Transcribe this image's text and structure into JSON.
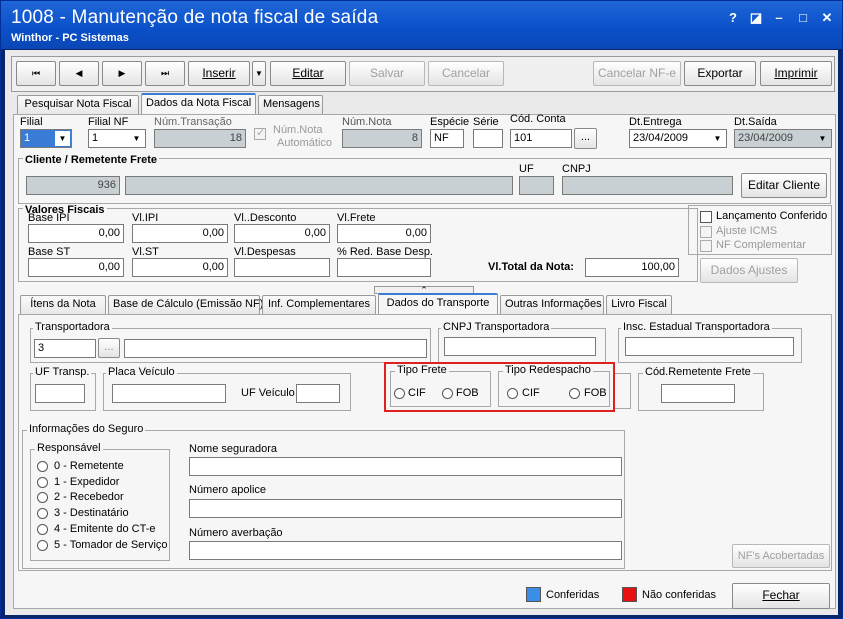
{
  "window": {
    "title": "1008 - Manutenção de nota fiscal de saída",
    "subtitle": "Winthor - PC Sistemas",
    "help": "?",
    "restore": "◪",
    "minimize": "–",
    "maximize": "□",
    "close": "✕"
  },
  "toolbar": {
    "first": "⏮",
    "prev": "◀",
    "next": "▶",
    "last": "⏭",
    "inserir": "Inserir",
    "inserir_drop": "▼",
    "editar": "Editar",
    "salvar": "Salvar",
    "cancelar": "Cancelar",
    "cancelar_nfe": "Cancelar NF-e",
    "exportar": "Exportar",
    "imprimir": "Imprimir"
  },
  "top_tabs": [
    "Pesquisar Nota Fiscal",
    "Dados da Nota Fiscal",
    "Mensagens"
  ],
  "header": {
    "filial_label": "Filial",
    "filial_value": "1",
    "filial_nf_label": "Filial NF",
    "filial_nf_value": "1",
    "num_transacao_label": "Núm.Transação",
    "num_transacao_value": "18",
    "num_nota_auto_label_1": "Núm.Nota",
    "num_nota_auto_label_2": "Automático",
    "num_nota_label": "Núm.Nota",
    "num_nota_value": "8",
    "especie_label": "Espécie",
    "especie_value": "NF",
    "serie_label": "Série",
    "serie_value": "",
    "cod_conta_label": "Cód. Conta",
    "cod_conta_value": "101",
    "cod_conta_btn": "...",
    "dt_entrega_label": "Dt.Entrega",
    "dt_entrega_value": "23/04/2009",
    "dt_saida_label": "Dt.Saída",
    "dt_saida_value": "23/04/2009"
  },
  "cliente": {
    "title": "Cliente / Remetente Frete",
    "code": "936",
    "name": "",
    "uf_label": "UF",
    "uf_value": "",
    "cnpj_label": "CNPJ",
    "cnpj_value": "",
    "editar_btn": "Editar Cliente"
  },
  "valores": {
    "title": "Valores Fiscais",
    "base_ipi_label": "Base IPI",
    "base_ipi": "0,00",
    "vl_ipi_label": "Vl.IPI",
    "vl_ipi": "0,00",
    "vl_desconto_label": "Vl..Desconto",
    "vl_desconto": "0,00",
    "vl_frete_label": "Vl.Frete",
    "vl_frete": "0,00",
    "base_st_label": "Base ST",
    "base_st": "0,00",
    "vl_st_label": "Vl.ST",
    "vl_st": "0,00",
    "vl_despesas_label": "Vl.Despesas",
    "vl_despesas": "",
    "red_base_label": "% Red. Base Desp.",
    "red_base": "",
    "vl_total_label": "Vl.Total da Nota:",
    "vl_total": "100,00"
  },
  "flags": {
    "lancamento": "Lançamento Conferido",
    "ajuste_icms": "Ajuste ICMS",
    "nf_complementar": "NF Complementar",
    "dados_ajustes": "Dados Ajustes"
  },
  "sub_tabs": [
    "Ítens da Nota",
    "Base de Cálculo (Emissão NF)",
    "Inf. Complementares",
    "Dados do Transporte",
    "Outras Informações",
    "Livro Fiscal"
  ],
  "collapse_arrow": "⌃",
  "transporte": {
    "transportadora_label": "Transportadora",
    "transportadora_code": "3",
    "transportadora_btn": "...",
    "transportadora_name": "",
    "cnpj_transp_label": "CNPJ Transportadora",
    "cnpj_transp_value": "",
    "insc_estadual_label": "Insc. Estadual Transportadora",
    "insc_estadual_value": "",
    "uf_transp_label": "UF Transp.",
    "uf_transp_value": "",
    "placa_label": "Placa Veículo",
    "placa_value": "",
    "uf_veiculo_label": "UF Veículo",
    "uf_veiculo_value": "",
    "tipo_frete_label": "Tipo Frete",
    "tipo_frete_cif": "CIF",
    "tipo_frete_fob": "FOB",
    "tipo_redespacho_label": "Tipo Redespacho",
    "tipo_redespacho_cif": "CIF",
    "tipo_redespacho_fob": "FOB",
    "cod_remetente_label": "Cód.Remetente Frete",
    "cod_remetente_value": ""
  },
  "seguro": {
    "title": "Informações do Seguro",
    "responsavel_label": "Responsável",
    "options": [
      "0 - Remetente",
      "1 - Expedidor",
      "2 - Recebedor",
      "3 - Destinatário",
      "4 - Emitente do CT-e",
      "5 - Tomador de Serviço"
    ],
    "seguradora_label": "Nome seguradora",
    "seguradora_value": "",
    "apolice_label": "Número apolice",
    "apolice_value": "",
    "averbacao_label": "Número averbação",
    "averbacao_value": ""
  },
  "nfs_acobertadas": "NF's Acobertadas",
  "legend": {
    "conferidas": "Conferidas",
    "nao_conferidas": "Não conferidas",
    "conferidas_color": "#3a8ee6",
    "nao_conferidas_color": "#e81010"
  },
  "fechar": "Fechar",
  "highlight_color": "#e02020"
}
